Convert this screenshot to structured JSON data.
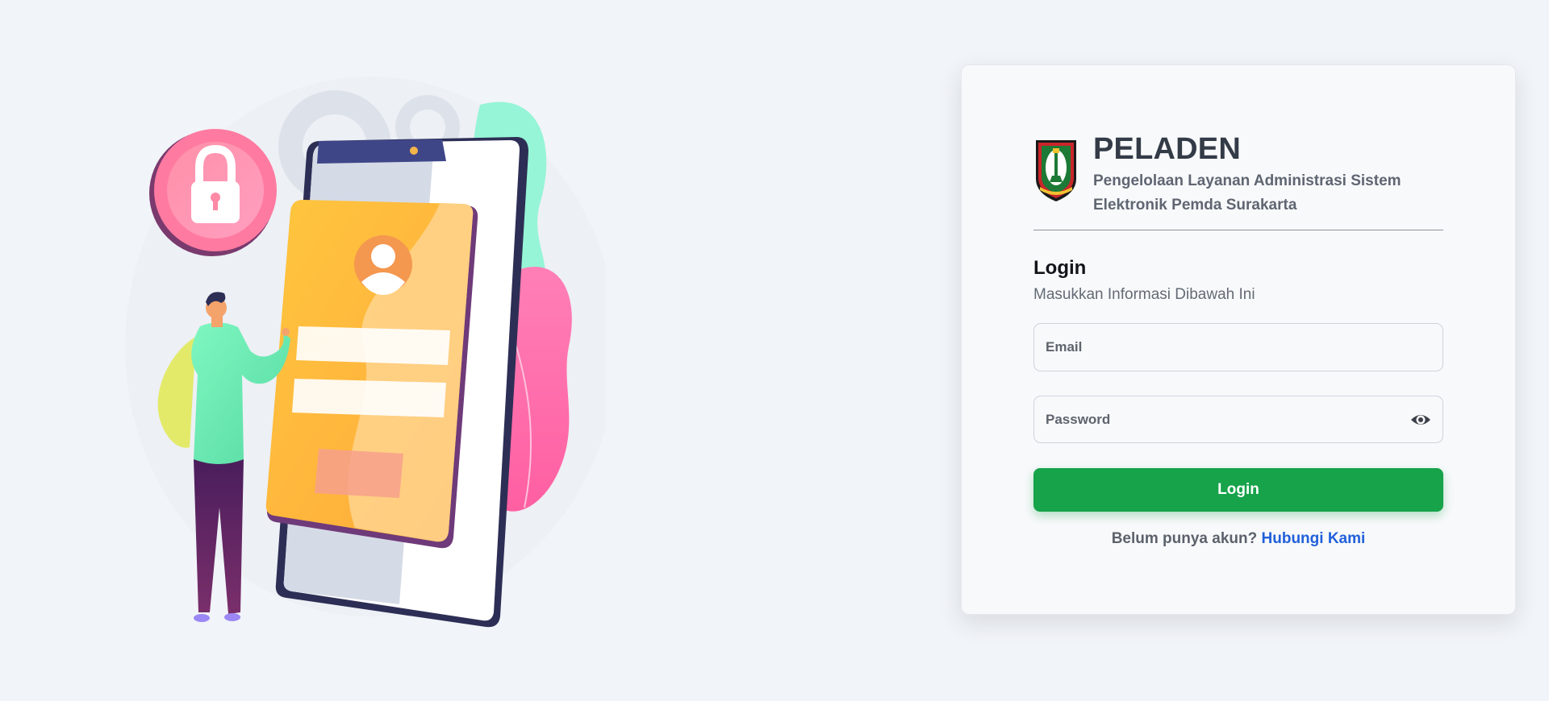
{
  "brand": {
    "title": "PELADEN",
    "subtitle": "Pengelolaan Layanan Administrasi Sistem Elektronik Pemda Surakarta",
    "logo_icon": "surakarta-emblem-icon"
  },
  "login": {
    "heading": "Login",
    "subheading": "Masukkan Informasi Dibawah Ini",
    "email": {
      "placeholder": "Email",
      "value": ""
    },
    "password": {
      "placeholder": "Password",
      "value": "",
      "toggle_icon": "eye-icon"
    },
    "button_label": "Login",
    "signup_prompt": "Belum punya akun?",
    "signup_link": "Hubungi Kami"
  },
  "colors": {
    "background": "#f1f4f8",
    "primary_button": "#16a34a",
    "link": "#2160d9",
    "title": "#333b47"
  },
  "illustration": {
    "icons": [
      "lock-icon",
      "gear-icon",
      "smartphone-icon",
      "user-avatar-icon",
      "person-figure",
      "leaf-decoration"
    ]
  }
}
